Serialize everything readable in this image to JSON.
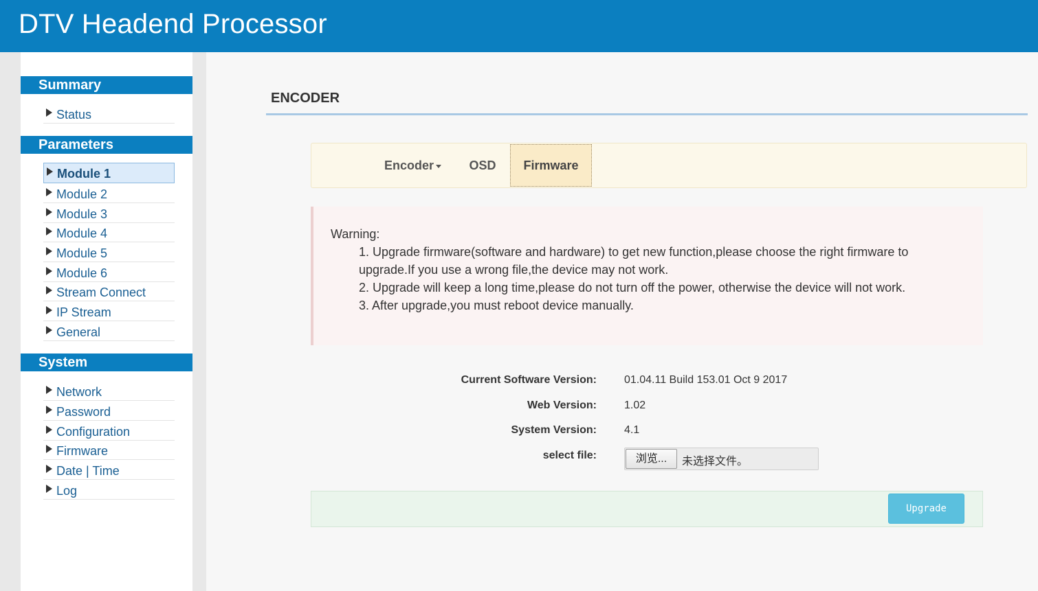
{
  "app": {
    "title": "DTV Headend Processor"
  },
  "sidebar": {
    "sections": [
      {
        "title": "Summary",
        "items": [
          "Status"
        ]
      },
      {
        "title": "Parameters",
        "items": [
          "Module 1",
          "Module 2",
          "Module 3",
          "Module 4",
          "Module 5",
          "Module 6",
          "Stream Connect",
          "IP Stream",
          "General"
        ],
        "active": "Module 1"
      },
      {
        "title": "System",
        "items": [
          "Network",
          "Password",
          "Configuration",
          "Firmware",
          "Date | Time",
          "Log"
        ]
      }
    ]
  },
  "page": {
    "title": "ENCODER"
  },
  "tabs": [
    {
      "label": "Encoder",
      "dropdown": true
    },
    {
      "label": "OSD"
    },
    {
      "label": "Firmware",
      "active": true
    }
  ],
  "warning": {
    "title": "Warning:",
    "lines": [
      "1. Upgrade firmware(software and hardware) to get new function,please choose the right firmware to",
      "upgrade.If you use a wrong file,the device may not work.",
      "2. Upgrade will keep a long time,please do not turn off the power, otherwise the device will not work.",
      "3. After upgrade,you must reboot device manually."
    ]
  },
  "info": {
    "software_label": "Current Software Version:",
    "software_value": "01.04.11 Build 153.01 Oct 9 2017",
    "web_label": "Web Version:",
    "web_value": "1.02",
    "system_label": "System Version:",
    "system_value": "4.1",
    "file_label": "select file:",
    "browse_label": "浏览...",
    "file_status": "未选择文件。"
  },
  "actions": {
    "upgrade_label": "Upgrade"
  },
  "colors": {
    "header": "#0b7fc0",
    "link": "#1a5f93",
    "upgrade": "#5bc0de"
  }
}
